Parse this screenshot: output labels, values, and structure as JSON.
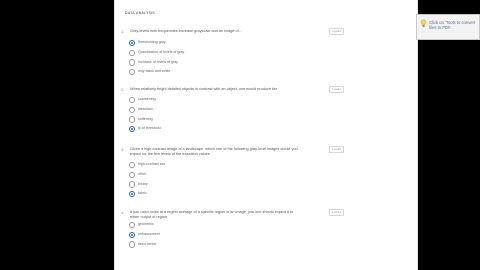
{
  "section_label": "DATA ANALYSIS",
  "popup_text": "Click on 'Tools to convert files to PDF.",
  "questions": [
    {
      "num": "1.",
      "text": "Gray-levels with frequencies increase grayscale and an image of...",
      "points": "1 point",
      "options": [
        {
          "label": "thresholding gray",
          "selected": true
        },
        {
          "label": "Quantization of levels of gray",
          "selected": false
        },
        {
          "label": "Increase of levels of gray",
          "selected": false
        },
        {
          "label": "only black and white",
          "selected": false
        }
      ]
    },
    {
      "num": "2.",
      "text": "When relatively bright detailed objects in contrast with an object, one would produce the",
      "points": "1 point",
      "options": [
        {
          "label": "coarsening",
          "selected": false
        },
        {
          "label": "distortion",
          "selected": false
        },
        {
          "label": "softening",
          "selected": false
        },
        {
          "label": "ip of threshold",
          "selected": true
        }
      ]
    },
    {
      "num": "3.",
      "text": "Given a high contrast image of a landscape, which one of the following gray-level images would you expect for the few levels of the transition values",
      "points": "1 point",
      "options": [
        {
          "label": "high-contrast bar",
          "selected": false
        },
        {
          "label": "other",
          "selected": false
        },
        {
          "label": "binary",
          "selected": false
        },
        {
          "label": "fabric",
          "selected": true
        }
      ]
    },
    {
      "num": "4.",
      "text": "If you used noise at a region average of a specific region in an image, you one should expect it to either output of region",
      "points": "1 point",
      "options": [
        {
          "label": "geometric",
          "selected": false
        },
        {
          "label": "enhancement",
          "selected": true
        },
        {
          "label": "fixed center",
          "selected": false
        }
      ]
    }
  ]
}
